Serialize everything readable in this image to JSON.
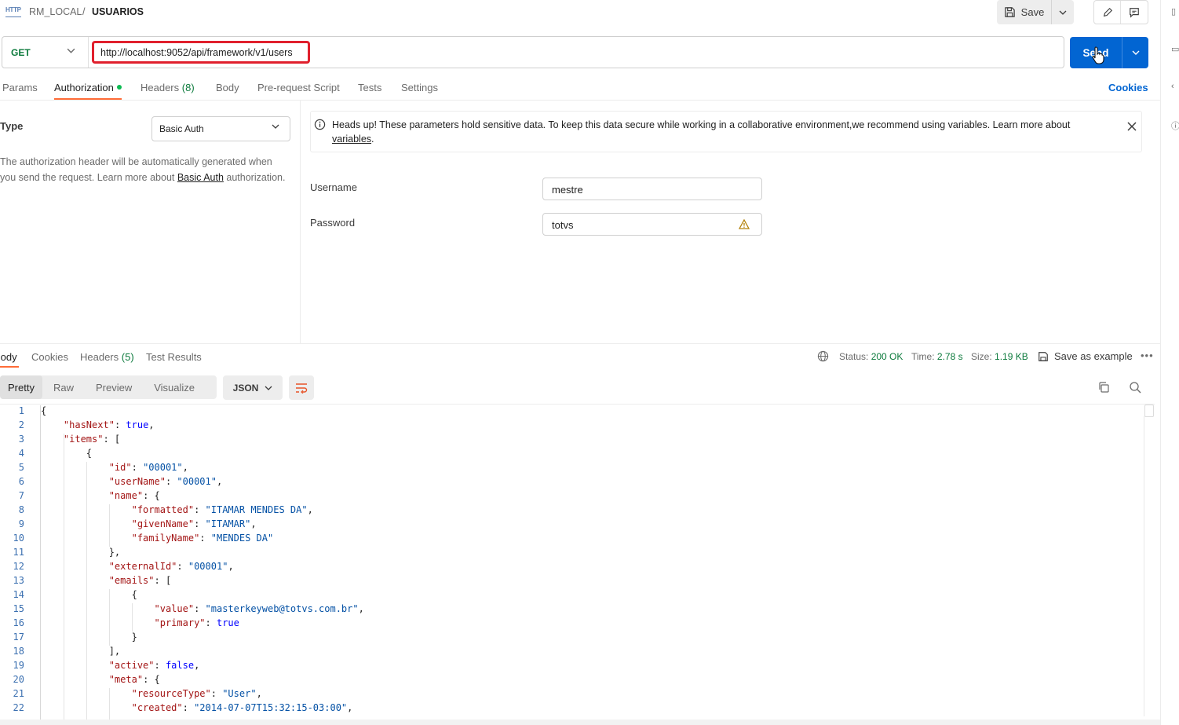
{
  "header": {
    "http_badge": "HTTP",
    "breadcrumb_parent": "RM_LOCAL",
    "breadcrumb_sep": "/",
    "breadcrumb_current": "USUARIOS",
    "save_label": "Save"
  },
  "request": {
    "method": "GET",
    "url": "http://localhost:9052/api/framework/v1/users",
    "send_label": "Send"
  },
  "request_tabs": {
    "params": "Params",
    "authorization": "Authorization",
    "headers": "Headers",
    "headers_count": "(8)",
    "body": "Body",
    "prerequest": "Pre-request Script",
    "tests": "Tests",
    "settings": "Settings",
    "cookies": "Cookies"
  },
  "auth": {
    "type_label": "Type",
    "type_value": "Basic Auth",
    "desc_before": "The authorization header will be automatically generated when you send the request. Learn more about ",
    "desc_link": "Basic Auth",
    "desc_after": " authorization.",
    "note_text": "Heads up! These parameters hold sensitive data. To keep this data secure while working in a collaborative environment,we recommend using variables. Learn more about ",
    "note_link": "variables",
    "note_end": ".",
    "username_label": "Username",
    "username_value": "mestre",
    "password_label": "Password",
    "password_value": "totvs"
  },
  "response_tabs": {
    "body": "Body",
    "cookies": "Cookies",
    "headers": "Headers",
    "headers_count": "(5)",
    "test_results": "Test Results"
  },
  "response_meta": {
    "status_label": "Status:",
    "status_value": "200 OK",
    "time_label": "Time:",
    "time_value": "2.78 s",
    "size_label": "Size:",
    "size_value": "1.19 KB",
    "save_example": "Save as example",
    "more": "•••"
  },
  "view": {
    "pretty": "Pretty",
    "raw": "Raw",
    "preview": "Preview",
    "visualize": "Visualize",
    "format": "JSON"
  },
  "code_lines": [
    "{",
    "    \"hasNext\": true,",
    "    \"items\": [",
    "        {",
    "            \"id\": \"00001\",",
    "            \"userName\": \"00001\",",
    "            \"name\": {",
    "                \"formatted\": \"ITAMAR MENDES DA\",",
    "                \"givenName\": \"ITAMAR\",",
    "                \"familyName\": \"MENDES DA\"",
    "            },",
    "            \"externalId\": \"00001\",",
    "            \"emails\": [",
    "                {",
    "                    \"value\": \"masterkeyweb@totvs.com.br\",",
    "                    \"primary\": true",
    "                }",
    "            ],",
    "            \"active\": false,",
    "            \"meta\": {",
    "                \"resourceType\": \"User\",",
    "                \"created\": \"2014-07-07T15:32:15-03:00\","
  ],
  "colors": {
    "accent": "#0265d2",
    "method_get": "#0c7a3c",
    "highlight_border": "#e0202d",
    "active_tab": "#ff6c37",
    "status_ok": "#0c7a3c"
  }
}
